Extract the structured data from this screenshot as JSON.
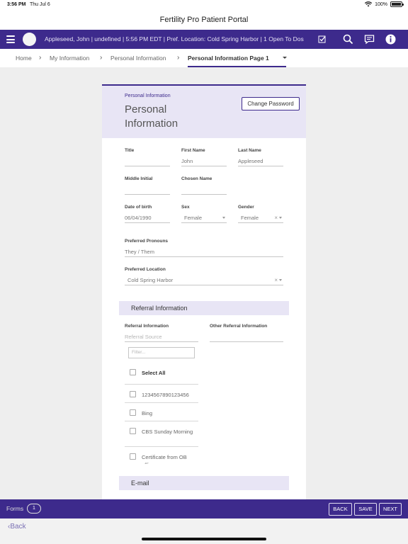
{
  "status_bar": {
    "time": "3:56 PM",
    "date": "Thu Jul 6",
    "battery": "100%"
  },
  "app_title": "Fertility Pro Patient Portal",
  "nav": {
    "patient_info": "Appleseed, John | undefined | 5:56 PM EDT | Pref. Location: Cold Spring Harbor | 1 Open To Dos"
  },
  "breadcrumb": {
    "home": "Home",
    "my_info": "My Information",
    "personal_info": "Personal Information",
    "current": "Personal Information Page 1"
  },
  "header": {
    "section_label": "Personal Information",
    "title": "Personal Information",
    "change_password": "Change Password"
  },
  "fields": {
    "title": {
      "label": "Title",
      "value": ""
    },
    "first_name": {
      "label": "First Name",
      "value": "John"
    },
    "last_name": {
      "label": "Last Name",
      "value": "Appleseed"
    },
    "middle_initial": {
      "label": "Middle Initial",
      "value": ""
    },
    "chosen_name": {
      "label": "Chosen Name",
      "value": ""
    },
    "dob": {
      "label": "Date of birth",
      "value": "06/04/1990"
    },
    "sex": {
      "label": "Sex",
      "value": "Female"
    },
    "gender": {
      "label": "Gender",
      "value": "Female"
    },
    "pronouns": {
      "label": "Preferred Pronouns",
      "value": "They / Them"
    },
    "location": {
      "label": "Preferred Location",
      "value": "Cold Spring Harbor"
    }
  },
  "referral": {
    "section_title": "Referral Information",
    "label": "Referral Information",
    "placeholder": "Referral Source",
    "filter_placeholder": "Filter...",
    "other_label": "Other Referral Information",
    "select_all": "Select All",
    "options": [
      "1234567890123456",
      "Bing",
      "CBS Sunday Morning",
      "Certificate from OB office"
    ]
  },
  "email": {
    "section_title": "E-mail"
  },
  "bottom": {
    "forms_label": "Forms",
    "forms_count": "1",
    "back": "BACK",
    "save": "SAVE",
    "next": "NEXT",
    "back_link": "Back"
  },
  "colors": {
    "primary": "#3d2a8c",
    "section_bg": "#e8e5f5"
  }
}
